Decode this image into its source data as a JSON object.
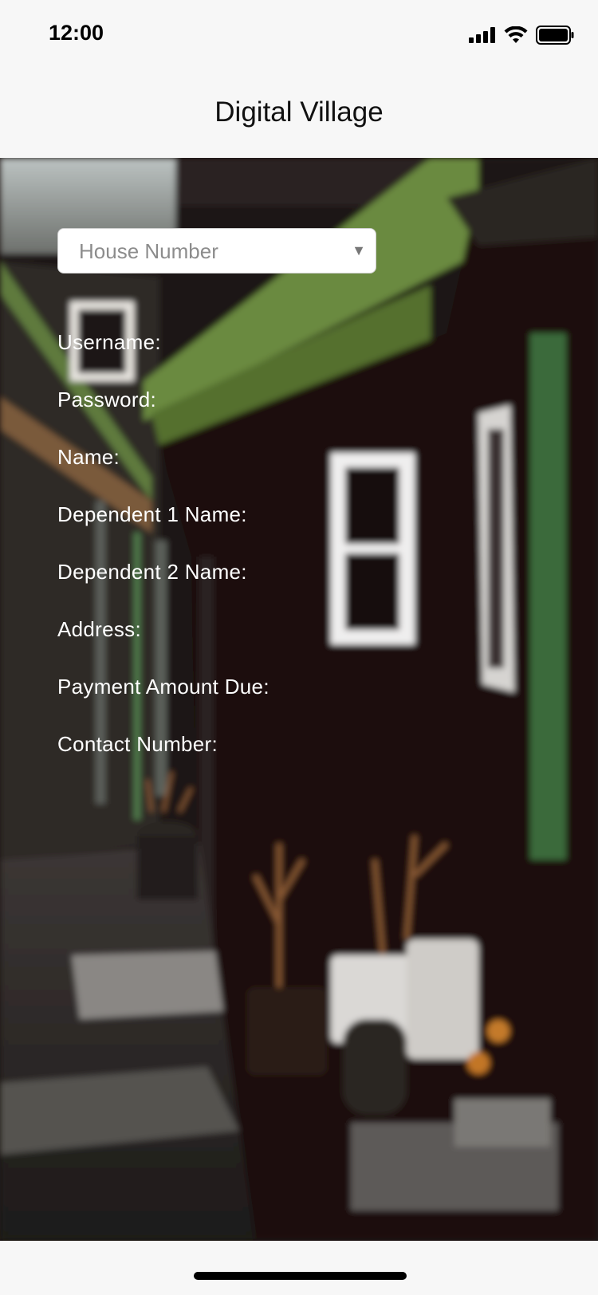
{
  "status_bar": {
    "time": "12:00",
    "signal_icon": "cellular-signal-icon",
    "wifi_icon": "wifi-icon",
    "battery_icon": "battery-icon"
  },
  "nav": {
    "title": "Digital Village"
  },
  "form": {
    "house_select": {
      "placeholder": "House Number",
      "caret_icon": "chevron-down-icon"
    },
    "labels": [
      "Username:",
      "Password:",
      "Name:",
      "Dependent 1 Name:",
      "Dependent 2 Name:",
      "Address:",
      "Payment Amount Due:",
      "Contact Number:"
    ]
  }
}
